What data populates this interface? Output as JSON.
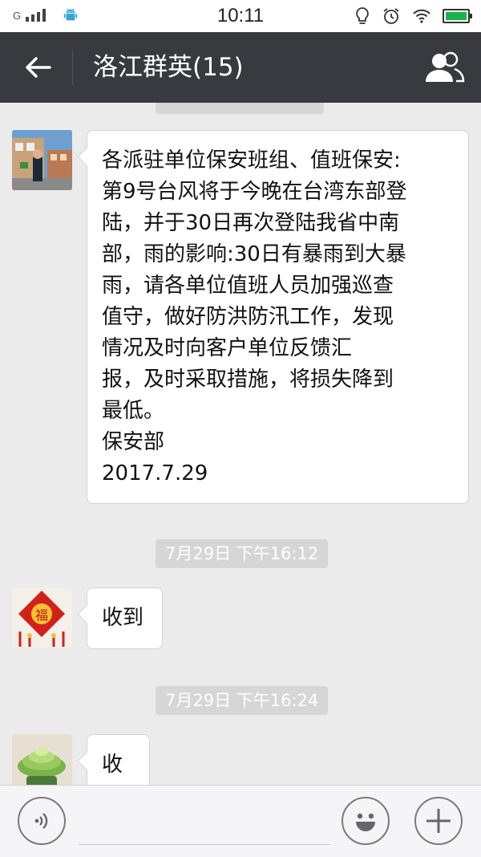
{
  "status_bar": {
    "network": "G",
    "time": "10:11"
  },
  "header": {
    "title": "洛江群英(15)"
  },
  "messages": [
    {
      "type": "text",
      "lines": [
        "各派驻单位保安班组、值班保安:",
        "第9号台风将于今晚在台湾东部登",
        "陆，并于30日再次登陆我省中南",
        "部，雨的影响:30日有暴雨到大暴",
        "雨，请各单位值班人员加强巡查",
        "值守，做好防洪防汛工作，发现",
        "情况及时向客户单位反馈汇",
        "报，及时采取措施，将损失降到",
        "最低。",
        "保安部",
        "2017.7.29"
      ]
    },
    {
      "type": "time",
      "label": "7月29日 下午16:12"
    },
    {
      "type": "text",
      "lines": [
        "收到"
      ]
    },
    {
      "type": "time",
      "label": "7月29日 下午16:24"
    },
    {
      "type": "text",
      "lines": [
        "收"
      ]
    }
  ],
  "colors": {
    "header_bg": "#393a3f",
    "chat_bg": "#ebebeb",
    "battery": "#18b34a"
  },
  "icons": {
    "back": "arrow-left-icon",
    "members": "group-icon",
    "voice": "voice-icon",
    "emoji": "smiley-icon",
    "plus": "plus-icon"
  }
}
